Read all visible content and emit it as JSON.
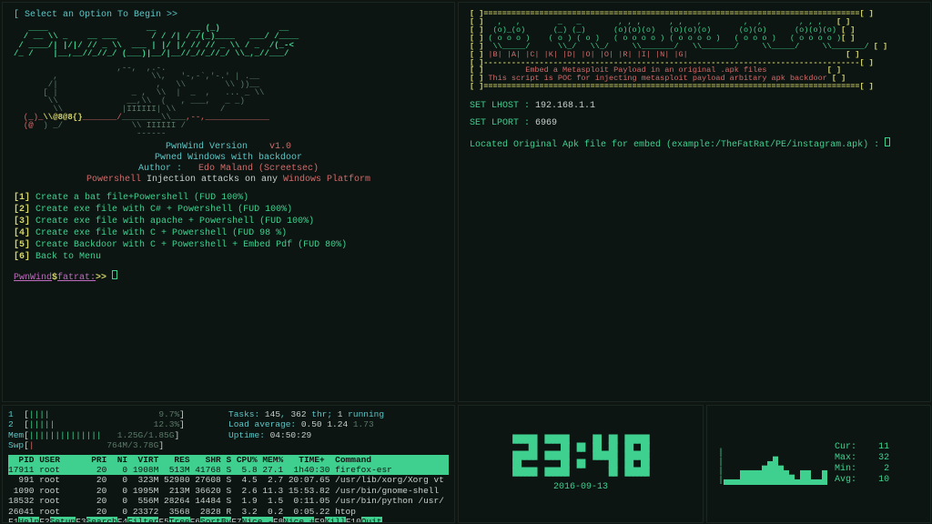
{
  "pwnwind": {
    "prompt_header": "[ Select an Option To Begin >>",
    "logo": "   ____                __       __ _             __    \n  / __ \\_    __  ___   / / /| / /(_) ___  ___  / /___ \n / /_/ /| |/|/ / / _ \\ | |/ |/ // / / _ \\/ _ \\(_-<\n/_ ___/ |__,__| /_//_/ |__/|__//_/ /_//_/\\_,_/___/",
    "skull": "                  ,--,  ,.-.\n        ,                   \\,   '-,-`,'-.' | .__\n       /                    \\   /        \\ ))__\n      (               _ ,  \\  |  _  ,   ... _ \\\n       \\              __,\\  (   , ___,   _ _)\n        \\            |IIIIII| \\         /\n  (_)_\\@8@8{}_______/________\\___,--,____________\n  (@)  / _/              \\ IIIIII /\n       ( _)                ------",
    "ver_label": "PwnWind Version",
    "ver_value": "v1.0",
    "subtitle": "Pwned Windows with backdoor",
    "author_label": "Author :",
    "author_value": "Edo Maland (Screetsec)",
    "desc_pre": "Powershell",
    "desc_mid": " Injection attacks on any ",
    "desc_post": "Windows Platform",
    "menu": [
      {
        "n": "[1]",
        "t": "Create a bat file+Powershell (FUD 100%)"
      },
      {
        "n": "[2]",
        "t": "Create exe file with C# + Powershell (FUD 100%)"
      },
      {
        "n": "[3]",
        "t": "Create exe file with apache + Powershell (FUD 100%)"
      },
      {
        "n": "[4]",
        "t": "Create exe file with C + Powershell (FUD 98 %)"
      },
      {
        "n": "[5]",
        "t": "Create Backdoor with C + Powershell + Embed Pdf (FUD 80%)"
      },
      {
        "n": "[6]",
        "t": "Back to Menu"
      }
    ],
    "prompt_user": "PwnWind",
    "prompt_sep": "$",
    "prompt_cmd": "fatrat:",
    "prompt_arrow": ">>"
  },
  "backdoor": {
    "box_top": "[ ]=================================================================================[ ]",
    "art": "[ ]   ,   ,                  ,  , ,  ,       ,  , ,        ,  ,       ,  , ,       [ ]\n[ ]  (o)_(o)    _     _     (o)(o)(o)       (o)(o)(o)     (o)(o)      (o)(o)(o)    [ ]\n[ ] (  o o  )  (_)   (_)   (  o o o  )    (  o o o  )   (  o o  )   (  o o o  )   [ ]\n[ ]  \\_____/    |     |     \\_______/      \\_______/     \\_____/     \\_______/    [ ]\n[ ]  |_B_| |_A_| |_C_| |_K_| |_D_| |_O_| |_O_| |_R_| |_I_| |_N_| |_G_|             [ ]",
    "box_mid": "[ ]---------------------------------------------------------------------------------[ ]",
    "tag1": "Embed a Metasploit Payload in an original .apk files",
    "tag2": "This script is POC for injecting metasploit payload arbitary apk backdoor",
    "lhost_label": "SET LHOST :",
    "lhost_value": "192.168.1.1",
    "lport_label": "SET LPORT :",
    "lport_value": "6969",
    "apk_prompt": "Located Original Apk file for embed (example:/TheFatRat/PE/instagram.apk) :"
  },
  "htop": {
    "cpu1": "1  [||||                    9.7%]",
    "cpu2": "2  [|||||                  12.3%]",
    "mem": "Mem[||||||||||||||1.25G/1.85G]",
    "swp": "Swp[|                764M/3.78G]",
    "tasks": "Tasks: 145, 362 thr; 1 running",
    "load": "Load average: 0.50 1.24 1.73",
    "uptime": "Uptime: 04:50:29",
    "header": "  PID USER      PRI  NI  VIRT   RES   SHR S CPU% MEM%   TIME+  Command",
    "rows": [
      "17911 root       20   0 1908M  513M 41768 S  5.8 27.1  1h40:30 firefox-esr",
      "  991 root       20   0  323M 52980 27608 S  4.5  2.7 20:07.65 /usr/lib/xorg/Xorg vt",
      " 1090 root       20   0 1995M  213M 36620 S  2.6 11.3 15:53.82 /usr/bin/gnome-shell",
      "18532 root       20   0  556M 28264 14484 S  1.9  1.5  0:11.05 /usr/bin/python /usr/",
      "26041 root       20   0 23372  3568  2828 R  3.2  0.2  0:05.22 htop"
    ],
    "fnkeys": [
      {
        "k": "F1",
        "l": "Help "
      },
      {
        "k": "F2",
        "l": "Setup "
      },
      {
        "k": "F3",
        "l": "Search"
      },
      {
        "k": "F4",
        "l": "Filter"
      },
      {
        "k": "F5",
        "l": "Tree "
      },
      {
        "k": "F6",
        "l": "SortBy"
      },
      {
        "k": "F7",
        "l": "Nice -"
      },
      {
        "k": "F8",
        "l": "Nice +"
      },
      {
        "k": "F9",
        "l": "Kill "
      },
      {
        "k": "F10",
        "l": "Quit"
      }
    ]
  },
  "clock": {
    "time": "23:48",
    "date": "2016-09-13"
  },
  "stats": {
    "cur_l": "Cur:",
    "cur_v": "11",
    "max_l": "Max:",
    "max_v": "32",
    "min_l": "Min:",
    "min_v": "2",
    "avg_l": "Avg:",
    "avg_v": "10",
    "chart": "|                   \n|        ▄█         \n|   ▄▄▄▄████▄  ▄▄  ▄\n|▄▄▄██████████▄██▄▄█"
  }
}
